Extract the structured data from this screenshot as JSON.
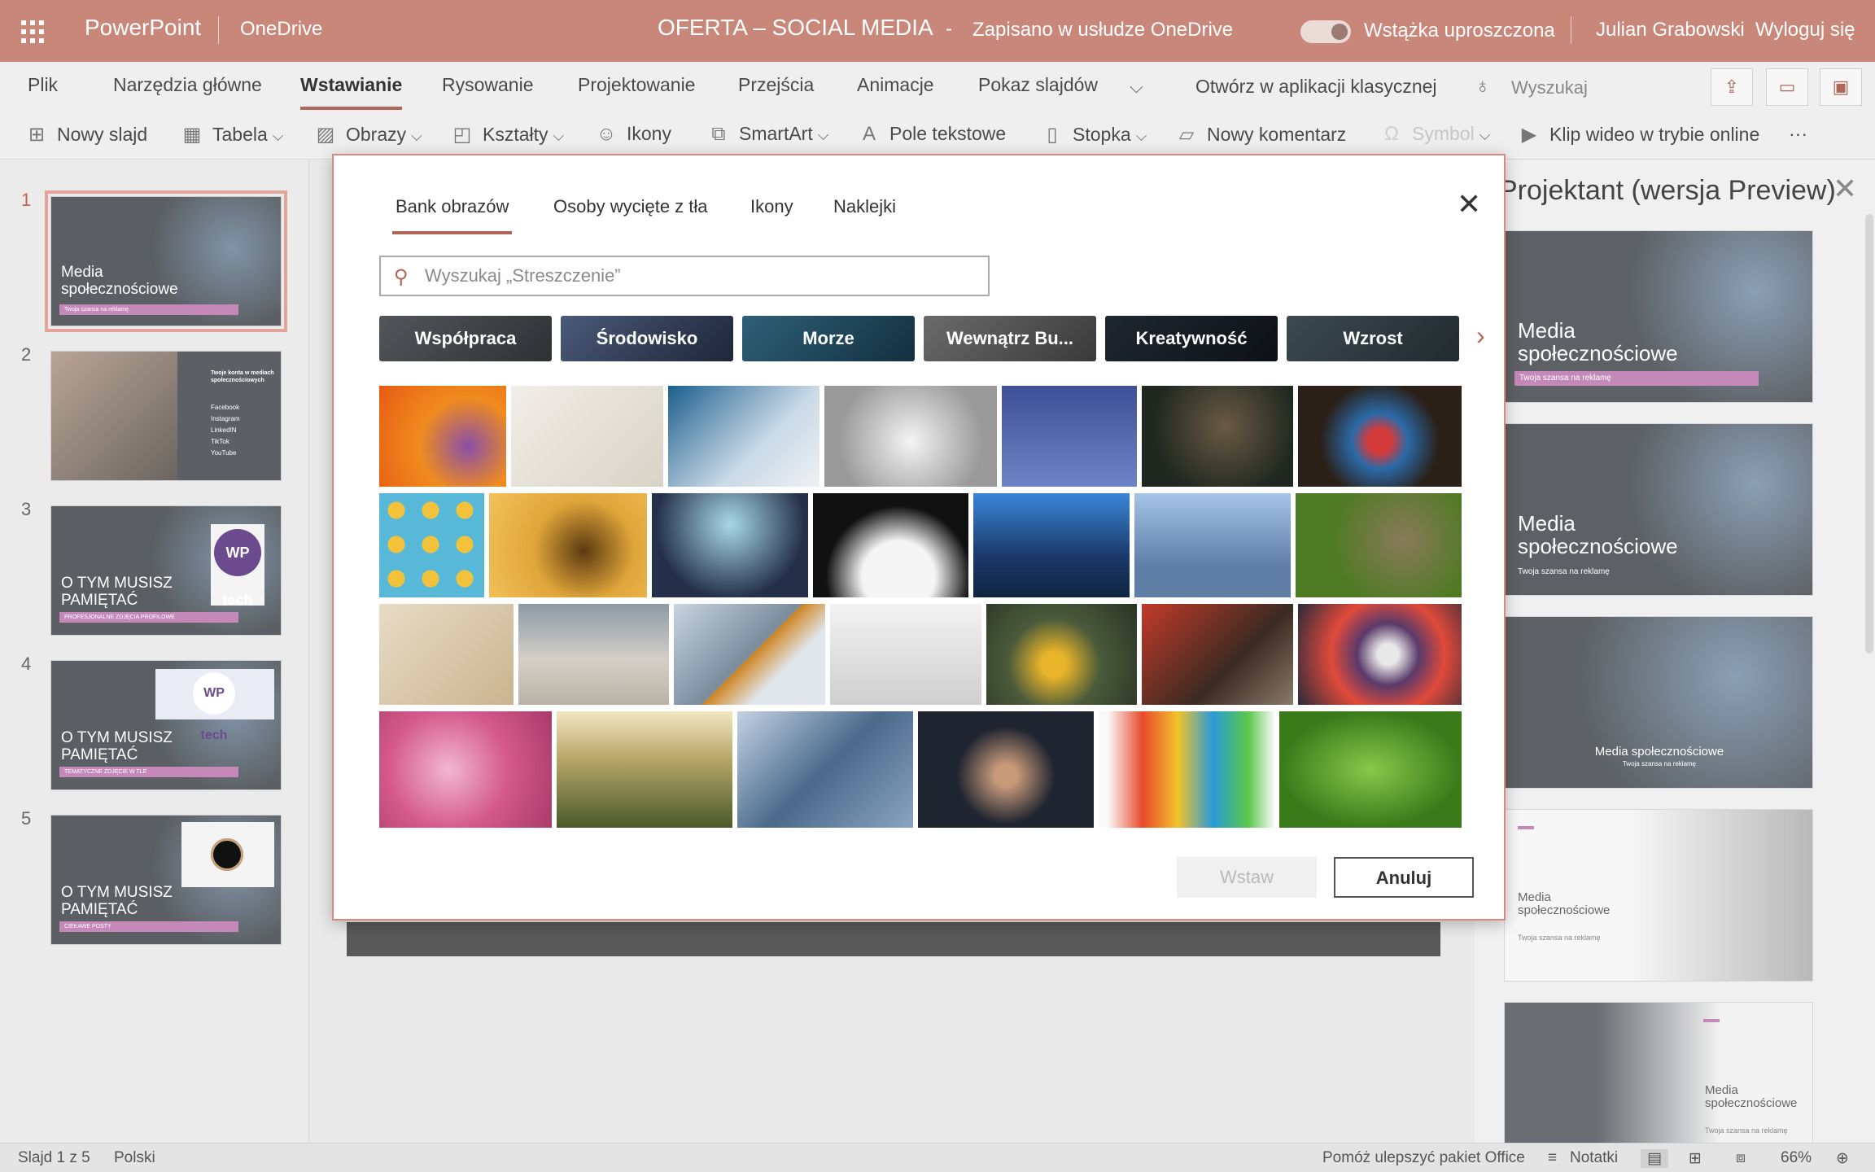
{
  "titlebar": {
    "app_name": "PowerPoint",
    "onedrive": "OneDrive",
    "doc_title": "OFERTA – SOCIAL MEDIA",
    "dash": "-",
    "saved_status": "Zapisano w usłudze OneDrive",
    "ribbon_mode": "Wstążka uproszczona",
    "user": "Julian Grabowski",
    "logout": "Wyloguj się"
  },
  "menu": {
    "items": [
      "Plik",
      "Narzędzia główne",
      "Wstawianie",
      "Rysowanie",
      "Projektowanie",
      "Przejścia",
      "Animacje",
      "Pokaz slajdów"
    ],
    "active": "Wstawianie",
    "open_desktop": "Otwórz w aplikacji klasycznej",
    "search": "Wyszukaj"
  },
  "ribbon": {
    "new_slide": "Nowy slajd",
    "table": "Tabela",
    "images": "Obrazy",
    "shapes": "Kształty",
    "icons": "Ikony",
    "smartart": "SmartArt",
    "textbox": "Pole tekstowe",
    "footer": "Stopka",
    "new_comment": "Nowy komentarz",
    "symbol": "Symbol",
    "online_video": "Klip wideo w trybie online",
    "more": "···"
  },
  "slides": [
    {
      "num": "1",
      "title": "Media społecznościowe",
      "bar": "Twoja szansa na reklamę"
    },
    {
      "num": "2",
      "heading": "Twoje konta w mediach społecznościowych",
      "list": [
        "Facebook",
        "Instagram",
        "LinkedIN",
        "TikTok",
        "YouTube"
      ]
    },
    {
      "num": "3",
      "title": "O TYM MUSISZ PAMIĘTAĆ",
      "bar": "PROFESJONALNE ZDJĘCIA PROFILOWE",
      "logo": "WP tech"
    },
    {
      "num": "4",
      "title": "O TYM MUSISZ PAMIĘTAĆ",
      "bar": "TEMATYCZNE ZDJĘCIE W TLE",
      "logo": "WP tech"
    },
    {
      "num": "5",
      "title": "O TYM MUSISZ PAMIĘTAĆ",
      "bar": "CIEKAWE POSTY"
    }
  ],
  "designer": {
    "title": "Projektant (wersja Preview)",
    "cards": [
      {
        "title": "Media społecznościowe",
        "sub": "Twoja szansa na reklamę"
      },
      {
        "title": "Media społecznościowe",
        "sub": "Twoja szansa na reklamę"
      },
      {
        "title": "Media społecznościowe",
        "sub": "Twoja szansa na reklamę"
      },
      {
        "title": "Media społecznościowe",
        "sub": "Twoja szansa na reklamę"
      },
      {
        "title": "Media społecznościowe",
        "sub": "Twoja szansa na reklamę"
      }
    ]
  },
  "dialog": {
    "tabs": [
      "Bank obrazów",
      "Osoby wycięte z tła",
      "Ikony",
      "Naklejki"
    ],
    "active_tab": "Bank obrazów",
    "search_placeholder": "Wyszukaj „Streszczenie”",
    "categories": [
      "Współpraca",
      "Środowisko",
      "Morze",
      "Wewnątrz Bu...",
      "Kreatywność",
      "Wzrost"
    ],
    "insert": "Wstaw",
    "cancel": "Anuluj"
  },
  "status": {
    "slide": "Slajd 1 z 5",
    "language": "Polski",
    "help": "Pomóż ulepszyć pakiet Office",
    "notes": "Notatki",
    "zoom": "66%"
  },
  "colors": {
    "titlebar": "#c9877a",
    "accent": "#b0675a",
    "pink_bar": "#c489b9"
  }
}
